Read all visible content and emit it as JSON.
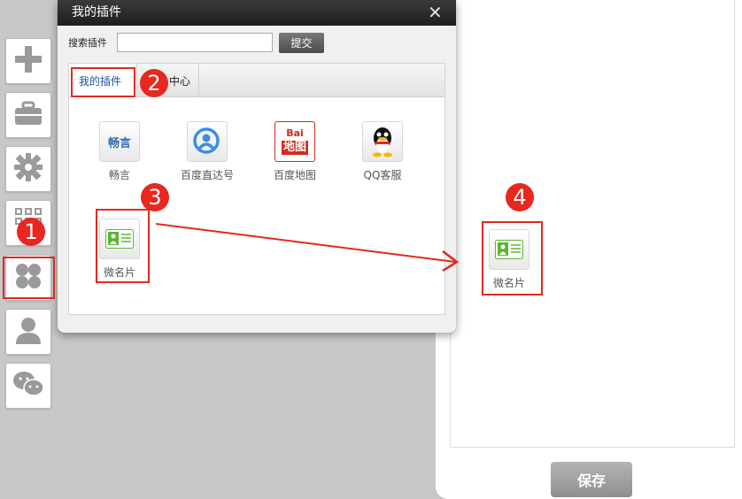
{
  "sidebar": {
    "items": [
      {
        "name": "add",
        "icon": "plus-icon"
      },
      {
        "name": "toolbox",
        "icon": "toolbox-icon"
      },
      {
        "name": "settings",
        "icon": "gear-icon"
      },
      {
        "name": "apps",
        "icon": "grid-icon"
      },
      {
        "name": "plugins",
        "icon": "clover-icon"
      },
      {
        "name": "user",
        "icon": "user-icon"
      },
      {
        "name": "wechat",
        "icon": "wechat-icon"
      }
    ]
  },
  "dialog": {
    "title": "我的插件",
    "close_glyph": "✕",
    "search_label": "搜索插件",
    "search_value": "",
    "submit_label": "提交",
    "tabs": [
      {
        "label": "我的插件",
        "active": true
      },
      {
        "label": "中心",
        "active": false
      }
    ],
    "plugins": [
      {
        "label": "畅言",
        "icon": "changyan-icon",
        "icon_text": "畅言"
      },
      {
        "label": "百度直达号",
        "icon": "baidu-direct-icon"
      },
      {
        "label": "百度地图",
        "icon": "baidu-map-icon",
        "icon_text_top": "Bai",
        "icon_text_bottom": "地图"
      },
      {
        "label": "QQ客服",
        "icon": "qq-icon"
      },
      {
        "label": "微名片",
        "icon": "business-card-icon"
      }
    ]
  },
  "canvas": {
    "placed_widget": {
      "label": "微名片",
      "icon": "business-card-icon"
    }
  },
  "save_label": "保存",
  "annotations": [
    "1",
    "2",
    "3",
    "4"
  ],
  "colors": {
    "annotation_red": "#e8271f",
    "dialog_title_bg": "#2b2b2b",
    "active_tab_text": "#1d4f9c",
    "card_green": "#5cb531"
  }
}
